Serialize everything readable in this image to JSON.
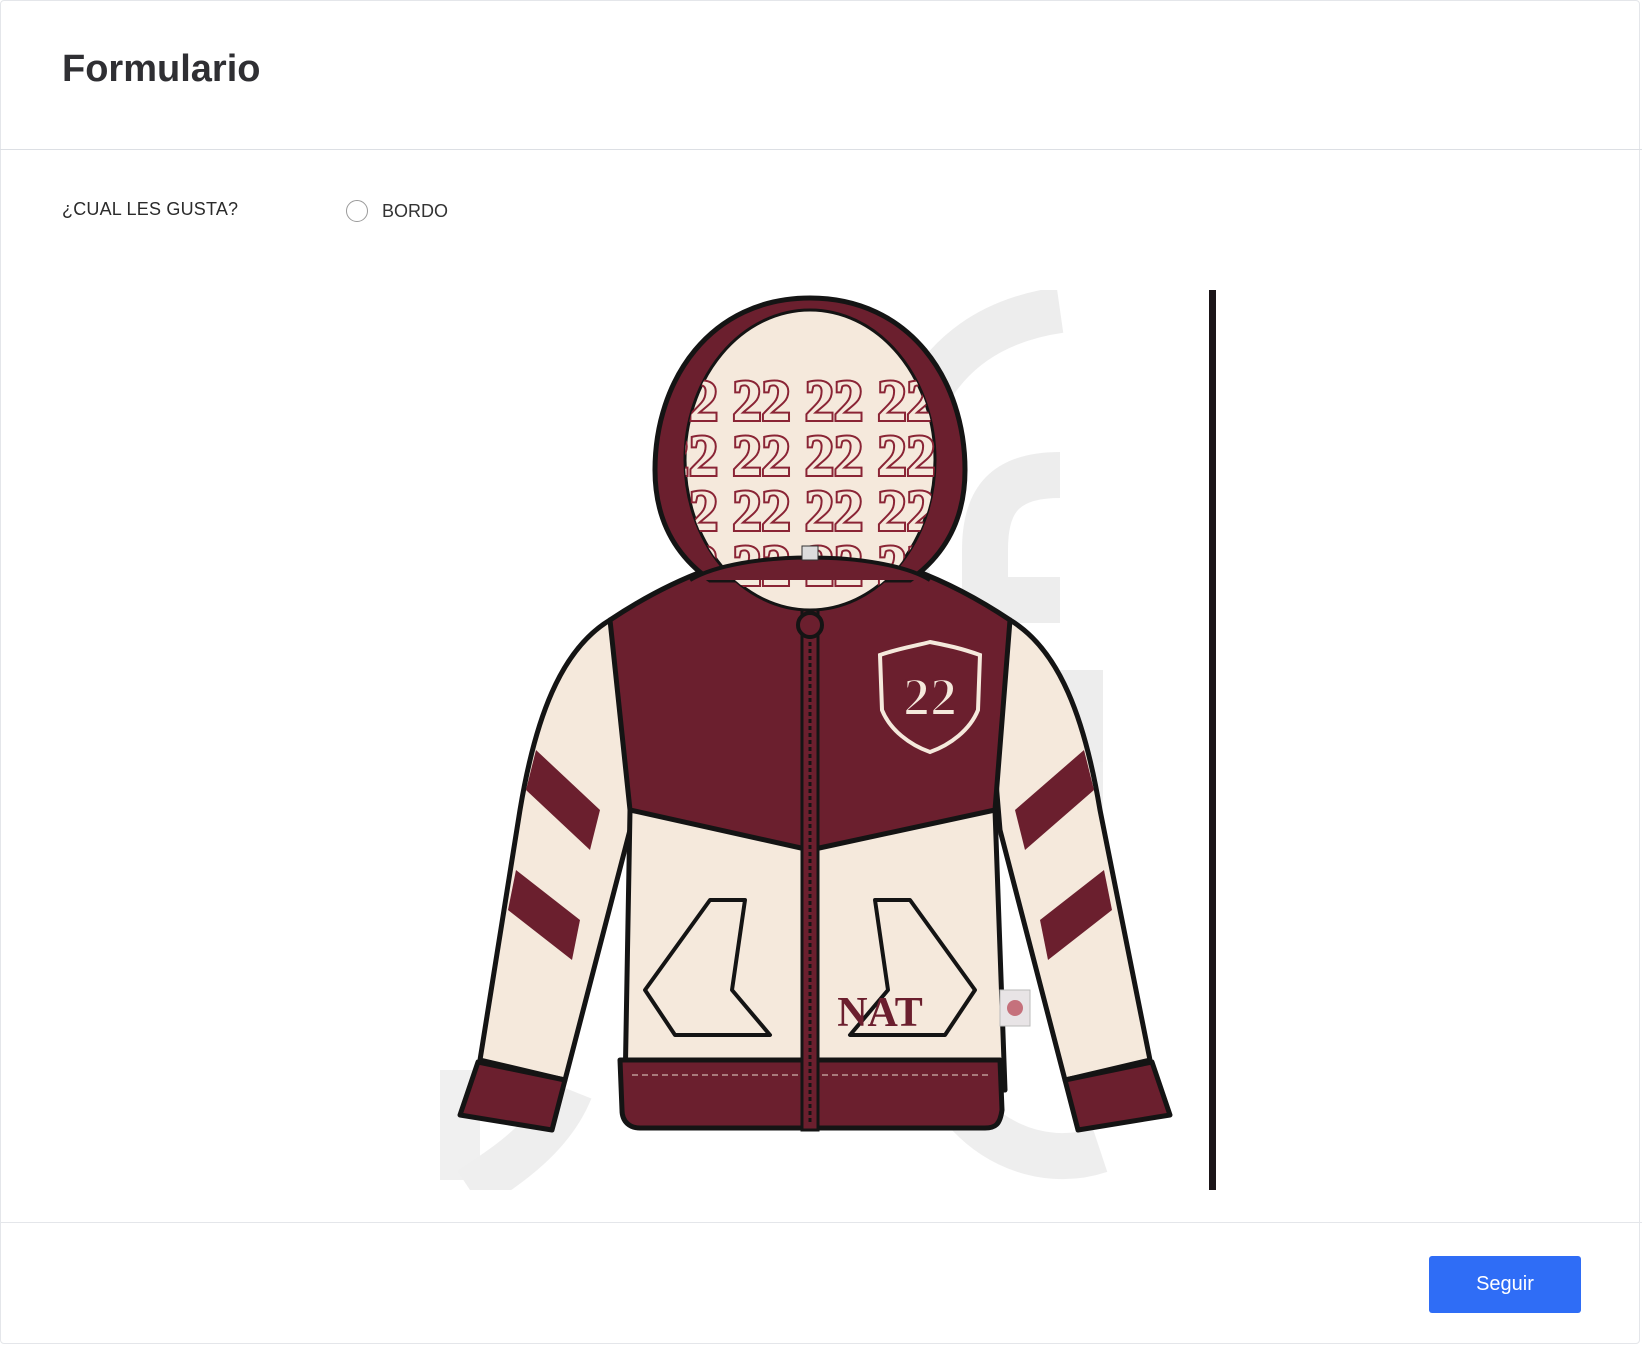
{
  "header": {
    "title": "Formulario"
  },
  "question": {
    "label": "¿CUAL LES GUSTA?",
    "options": [
      {
        "label": "BORDO",
        "selected": false
      }
    ]
  },
  "product": {
    "icon": "hoodie-design-image",
    "chest_badge": "22",
    "pattern_text": "22",
    "pocket_text": "NAT",
    "colors": {
      "primary": "#6b1f2e",
      "cream": "#f5e9dc",
      "outline": "#141414"
    }
  },
  "footer": {
    "next_label": "Seguir",
    "accent": "#2f6df6"
  }
}
